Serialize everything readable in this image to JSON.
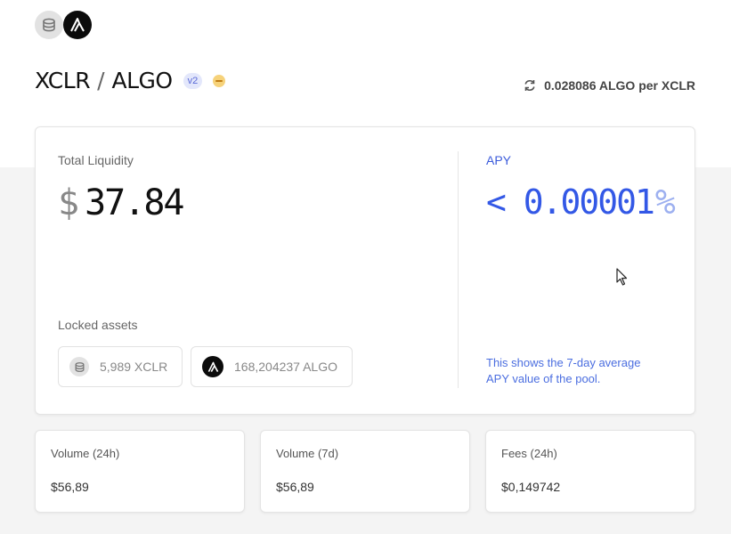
{
  "pool": {
    "asset_a": "XCLR",
    "asset_b": "ALGO",
    "separator": "/",
    "version": "v2",
    "price": "0.028086 ALGO per XCLR"
  },
  "liquidity": {
    "label": "Total Liquidity",
    "currency_symbol": "$",
    "value": "37.84"
  },
  "locked": {
    "label": "Locked assets",
    "assets": [
      {
        "amount": "5,989 XCLR",
        "icon": "xclr-coin-icon"
      },
      {
        "amount": "168,204237 ALGO",
        "icon": "algorand-logo-icon"
      }
    ]
  },
  "apy": {
    "label": "APY",
    "value": "< 0.00001",
    "unit": "%",
    "note": "This shows the 7-day average APY value of the pool."
  },
  "stats": [
    {
      "label": "Volume (24h)",
      "value": "$56,89"
    },
    {
      "label": "Volume (7d)",
      "value": "$56,89"
    },
    {
      "label": "Fees (24h)",
      "value": "$0,149742"
    }
  ],
  "colors": {
    "accent": "#3358e6",
    "badge_bg": "#e3e7fb",
    "warning": "#f6d27a"
  }
}
